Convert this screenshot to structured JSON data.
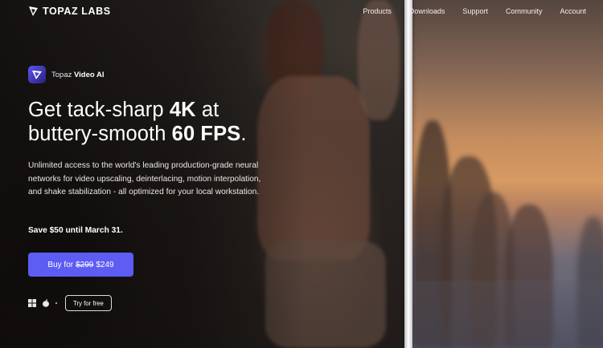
{
  "header": {
    "brand": "TOPAZ LABS",
    "nav": [
      "Products",
      "Downloads",
      "Support",
      "Community",
      "Account"
    ]
  },
  "product": {
    "prefix": "Topaz",
    "name": "Video AI"
  },
  "headline": {
    "line1_pre": "Get tack-sharp ",
    "line1_bold": "4K",
    "line1_post": " at",
    "line2_pre": "buttery-smooth ",
    "line2_bold": "60 FPS",
    "line2_post": "."
  },
  "description": "Unlimited access to the world's leading production-grade neural networks for video upscaling, deinterlacing, motion interpolation, and shake stabilization - all optimized for your local workstation.",
  "promo": "Save $50 until March 31.",
  "buy": {
    "label": "Buy for",
    "old_price": "$299",
    "new_price": "$249"
  },
  "trial_label": "Try for free",
  "icons": [
    "topaz-logo-icon",
    "video-ai-icon",
    "windows-icon",
    "apple-icon"
  ],
  "colors": {
    "accent": "#5d5cf3",
    "product_icon": "#4a43d8"
  }
}
